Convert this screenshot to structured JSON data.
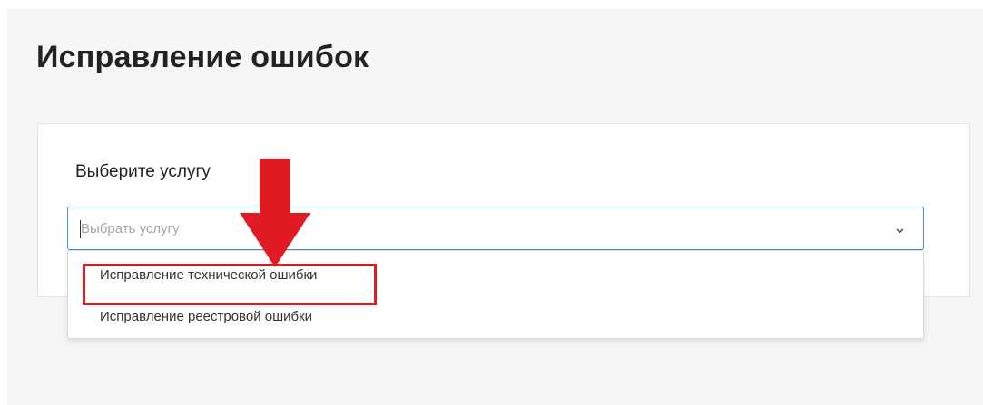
{
  "page": {
    "title": "Исправление ошибок"
  },
  "form": {
    "field_label": "Выберите услугу",
    "select": {
      "placeholder": "Выбрать услугу",
      "options": [
        "Исправление технической ошибки",
        "Исправление реестровой ошибки"
      ]
    }
  },
  "icons": {
    "chevron": "chevron-down-icon",
    "arrow": "down-arrow-annotation-icon"
  },
  "colors": {
    "annotation_red": "#e01b23",
    "focus_blue": "#3f8fdd"
  }
}
